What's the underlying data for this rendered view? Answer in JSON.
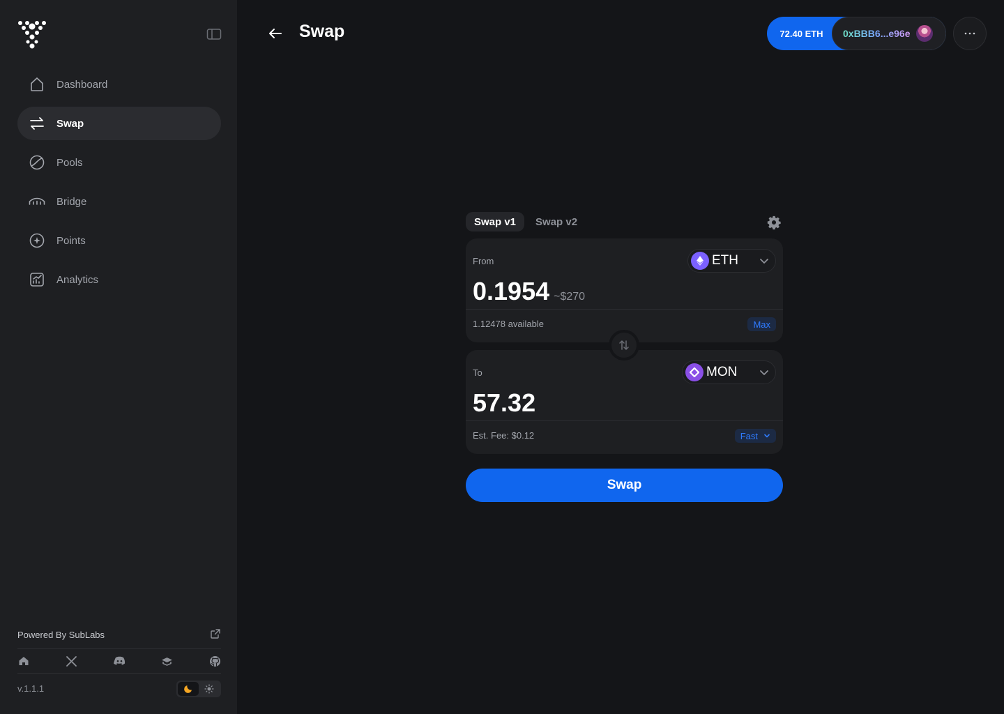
{
  "sidebar": {
    "items": [
      {
        "label": "Dashboard",
        "icon": "home-icon"
      },
      {
        "label": "Swap",
        "icon": "swap-arrows-icon"
      },
      {
        "label": "Pools",
        "icon": "pie-icon"
      },
      {
        "label": "Bridge",
        "icon": "bridge-icon"
      },
      {
        "label": "Points",
        "icon": "points-icon"
      },
      {
        "label": "Analytics",
        "icon": "analytics-icon"
      }
    ],
    "active": "Swap",
    "powered_by": "Powered By SubLabs",
    "version": "v.1.1.1"
  },
  "header": {
    "title": "Swap",
    "balance": "72.40 ETH",
    "address": "0xBBB6...e96e"
  },
  "swap": {
    "tabs": [
      "Swap v1",
      "Swap v2"
    ],
    "active_tab": "Swap v1",
    "from": {
      "label": "From",
      "token": "ETH",
      "amount": "0.1954",
      "usd": "~$270",
      "available": "1.12478 available",
      "max_label": "Max"
    },
    "to": {
      "label": "To",
      "token": "MON",
      "amount": "57.32",
      "fee": "Est. Fee: $0.12",
      "speed": "Fast"
    },
    "button_label": "Swap"
  },
  "colors": {
    "accent": "#1066ee",
    "background": "#141518",
    "sidebar": "#1e1f22",
    "eth": "#7b61ff",
    "mon": "#8a4fe6",
    "moon": "#f5a623"
  }
}
